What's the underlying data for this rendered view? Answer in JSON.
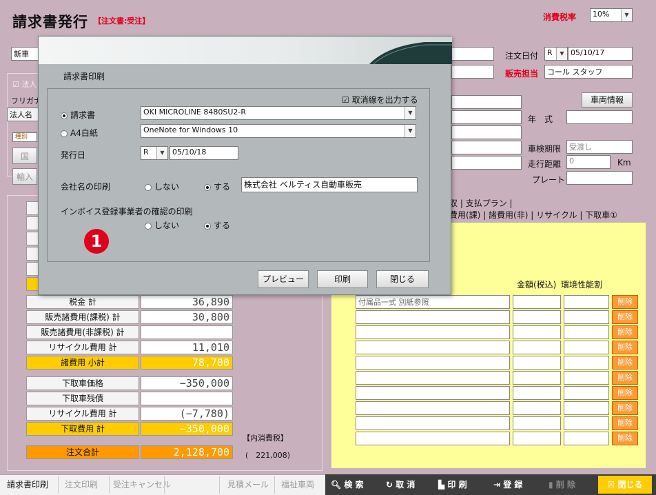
{
  "header": {
    "title": "請求書発行",
    "subtitle": "【注文書:受注】",
    "tax_label": "消費税率",
    "tax_value": "10%"
  },
  "form": {
    "vehicle": "新車",
    "order_date_label": "注文日付",
    "order_era": "R",
    "order_date": "05/10/17",
    "sales_rep_label": "販売担当",
    "sales_rep": "コール スタッフ",
    "corp_label": "法人",
    "furigana_label": "フリガナ",
    "corp_name_label": "法人名",
    "type_label": "種別",
    "domestic_label": "国",
    "import_label": "輸入",
    "vehicle_info_button": "車両情報",
    "year_label": "年　式",
    "inspection_label": "車検期限",
    "inspection_value": "受渡し",
    "mileage_label": "走行距離",
    "mileage_value": "0",
    "mileage_unit": "Km",
    "plate_label": "プレート"
  },
  "summary": [
    {
      "label": "税金 計",
      "value": "36,890",
      "style": ""
    },
    {
      "label": "販売諸費用(課税) 計",
      "value": "30,800",
      "style": ""
    },
    {
      "label": "販売諸費用(非課税) 計",
      "value": "",
      "style": ""
    },
    {
      "label": "リサイクル費用 計",
      "value": "11,010",
      "style": ""
    },
    {
      "label": "諸費用 小計",
      "value": "78,700",
      "style": "gold"
    },
    {
      "label": "下取車価格",
      "value": "−350,000",
      "style": ""
    },
    {
      "label": "下取車残債",
      "value": "",
      "style": ""
    },
    {
      "label": "リサイクル費用 計",
      "value": "(−7,780)",
      "style": ""
    },
    {
      "label": "下取費用 計",
      "value": "−350,000",
      "style": "gold"
    },
    {
      "label": "注文合計",
      "value": "2,128,700",
      "style": "orange"
    }
  ],
  "tax_inclusive": {
    "label": "【内消費税】",
    "value": "(　221,008)"
  },
  "tabs": {
    "row1_part": "収",
    "payment_plan": "支払プラン",
    "costs_taxable_part": "費用(課)",
    "costs_nontaxable": "諸費用(非)",
    "recycle": "リサイクル",
    "tradein1": "下取車①"
  },
  "table": {
    "col_amount": "金額(税込)",
    "col_env": "環境性能割",
    "first_row_text": "付属品一式 別紙参照",
    "delete_label": "削除"
  },
  "dialog": {
    "title": "請求書印刷",
    "cancel_line_label": "取消線を出力する",
    "invoice_label": "請求書",
    "invoice_printer": "OKI MICROLINE 8480SU2-R",
    "a4_label": "A4白紙",
    "a4_printer": "OneNote for Windows 10",
    "issue_date_label": "発行日",
    "issue_era": "R",
    "issue_date": "05/10/18",
    "company_print_label": "会社名の印刷",
    "no_label": "しない",
    "yes_label": "する",
    "company_name": "株式会社 ベルティス自動車販売",
    "invoice_reg_label": "インボイス登録事業者の確認の印刷",
    "badge": "1",
    "preview_button": "プレビュー",
    "print_button": "印刷",
    "close_button": "閉じる"
  },
  "toolbar": {
    "invoice_print": "請求書印刷",
    "order_print": "注文印刷",
    "order_cancel": "受注キャンセル",
    "estimate_mail": "見積メール",
    "welfare": "福祉車両",
    "search": "検 索",
    "cancel": "取 消",
    "print": "印 刷",
    "register": "登 録",
    "delete": "削 除",
    "close": "閉じる"
  },
  "colors": {
    "background": "#c9b0bd",
    "accent_red": "#e0001b",
    "yellow_panel": "#ffff99",
    "gold": "#ffcc00",
    "orange": "#ff9900",
    "delete": "#ff9933",
    "dialog": "#b3b8ba",
    "toolbar": "#3d3d3d"
  }
}
